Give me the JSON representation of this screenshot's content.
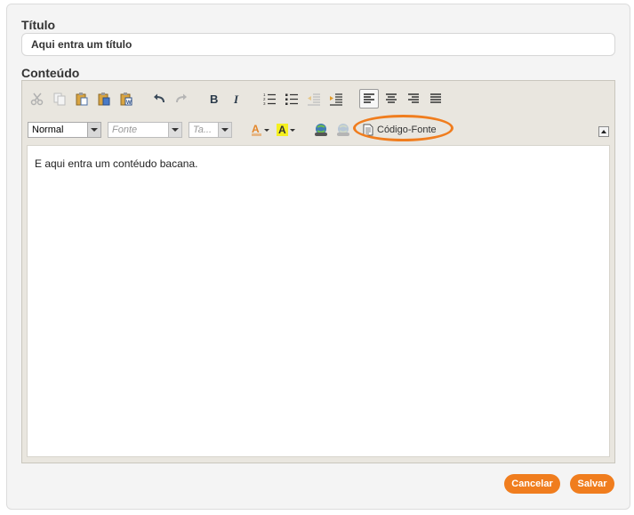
{
  "form": {
    "title_label": "Título",
    "title_value": "Aqui entra um título",
    "content_label": "Conteúdo"
  },
  "editor": {
    "toolbar1": [
      {
        "name": "cut-icon",
        "enabled": false
      },
      {
        "name": "copy-icon",
        "enabled": false
      },
      {
        "name": "paste-icon",
        "enabled": true
      },
      {
        "name": "paste-text-icon",
        "enabled": true
      },
      {
        "name": "paste-word-icon",
        "enabled": true
      },
      {
        "name": "undo-icon",
        "enabled": true
      },
      {
        "name": "redo-icon",
        "enabled": false
      },
      {
        "name": "bold-icon",
        "enabled": true
      },
      {
        "name": "italic-icon",
        "enabled": true
      },
      {
        "name": "numbered-list-icon",
        "enabled": true
      },
      {
        "name": "bulleted-list-icon",
        "enabled": true
      },
      {
        "name": "outdent-icon",
        "enabled": false
      },
      {
        "name": "indent-icon",
        "enabled": true
      },
      {
        "name": "align-left-icon",
        "enabled": true,
        "active": true
      },
      {
        "name": "align-center-icon",
        "enabled": true
      },
      {
        "name": "align-right-icon",
        "enabled": true
      },
      {
        "name": "align-justify-icon",
        "enabled": true
      }
    ],
    "format_combo": "Normal",
    "font_combo": "Fonte",
    "size_combo": "Ta...",
    "source_button_label": "Código-Fonte",
    "highlight_color": "#f07d1e",
    "content_text": "E aqui entra um contéudo bacana."
  },
  "actions": {
    "cancel_label": "Cancelar",
    "save_label": "Salvar",
    "button_color": "#f07d1e"
  }
}
